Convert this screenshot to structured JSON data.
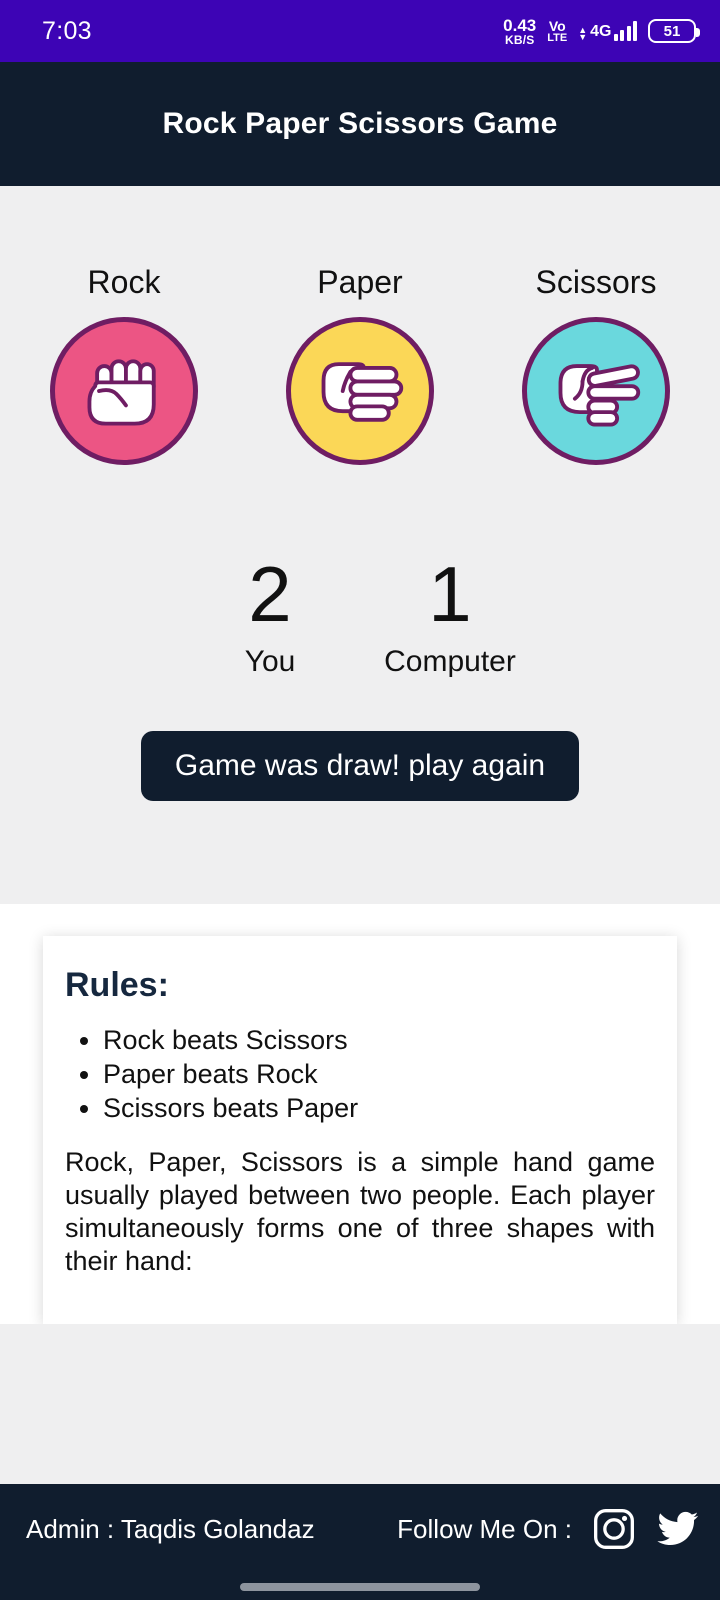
{
  "status_bar": {
    "time": "7:03",
    "net_speed_value": "0.43",
    "net_speed_unit": "KB/S",
    "volte_top": "Vo",
    "volte_bottom": "LTE",
    "network_type": "4G",
    "battery_level": "51",
    "background_color": "#3d04b5"
  },
  "header": {
    "title": "Rock Paper Scissors Game",
    "background_color": "#101d2e"
  },
  "game": {
    "choices": [
      {
        "label": "Rock",
        "icon": "fist-hand-icon",
        "color": "#ec5584"
      },
      {
        "label": "Paper",
        "icon": "flat-hand-icon",
        "color": "#fbd757"
      },
      {
        "label": "Scissors",
        "icon": "two-finger-hand-icon",
        "color": "#6ad8dd"
      }
    ],
    "border_color": "#6f1d63",
    "scores": [
      {
        "value": "2",
        "label": "You"
      },
      {
        "value": "1",
        "label": "Computer"
      }
    ],
    "result_message": "Game was draw! play again",
    "background_color": "#efeff0"
  },
  "rules": {
    "heading": "Rules:",
    "items": [
      "Rock beats Scissors",
      "Paper beats Rock",
      "Scissors beats Paper"
    ],
    "paragraph": "Rock, Paper, Scissors is a simple hand game usually played between two people. Each player simultaneously forms one of three shapes with their hand:",
    "heading_color": "#16283f"
  },
  "footer": {
    "admin_label": "Admin :  Taqdis Golandaz",
    "follow_label": "Follow Me On :",
    "socials": [
      {
        "name": "instagram-icon"
      },
      {
        "name": "twitter-icon"
      }
    ],
    "background_color": "#101d2e"
  }
}
